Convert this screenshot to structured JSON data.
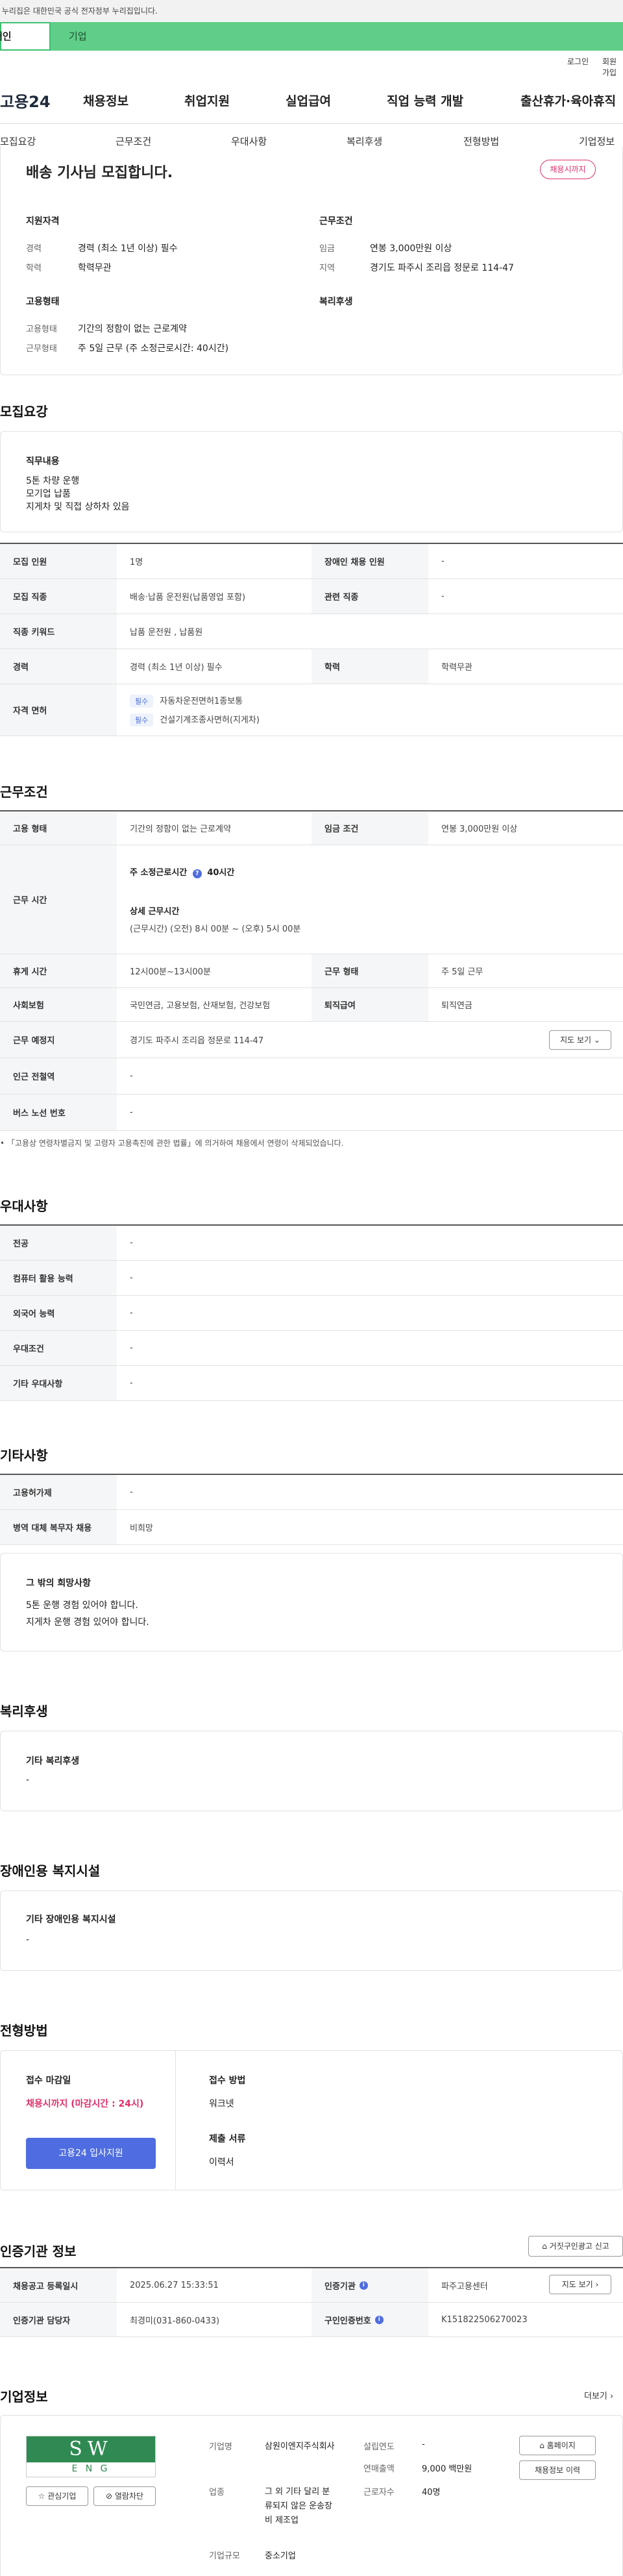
{
  "gov_banner": "이 누리집은 대한민국 공식 전자정부 누리집입니다.",
  "toggle": {
    "person": "개인",
    "corp": "기업"
  },
  "util": {
    "login": "로그인",
    "signup": "회원가입"
  },
  "logo": "고용24",
  "gnb": [
    "채용정보",
    "취업지원",
    "실업급여",
    "직업 능력 개발",
    "출산휴가·육아휴직"
  ],
  "tabs": [
    "모집요강",
    "근무조건",
    "우대사항",
    "복리후생",
    "전형방법",
    "기업정보"
  ],
  "job": {
    "title": "배송 기사님 모집합니다.",
    "badge": "채용시까지",
    "support_head": "지원자격",
    "career_label": "경력",
    "career_value": "경력 (최소 1년 이상) 필수",
    "edu_label": "학력",
    "edu_value": "학력무관",
    "work_head": "근무조건",
    "wage_label": "임금",
    "wage_value": "연봉 3,000만원 이상",
    "region_label": "지역",
    "region_value": "경기도 파주시 조리읍 정문로 114-47",
    "emp_head": "고용형태",
    "emp_type_label": "고용형태",
    "emp_type_value": "기간의 정함이 없는 근로계약",
    "work_type_label": "근무형태",
    "work_type_value": "주 5일 근무 (주 소정근로시간: 40시간)",
    "welfare_head": "복리후생"
  },
  "recruit": {
    "title": "모집요강",
    "duty_head": "직무내용",
    "duty_lines": [
      "5톤 차량 운행",
      "모기업 납품",
      "지게차 및 직접 상하차 있음"
    ],
    "rows": [
      {
        "k1": "모집 인원",
        "v1": "1명",
        "k2": "장애인 채용 인원",
        "v2": "-"
      },
      {
        "k1": "모집 직종",
        "v1": "배송·납품 운전원(납품영업 포함)",
        "k2": "관련 직종",
        "v2": "-"
      },
      {
        "k1": "직종 키워드",
        "v1": "납품 운전원 , 납품원"
      },
      {
        "k1": "경력",
        "v1": "경력 (최소 1년 이상) 필수",
        "k2": "학력",
        "v2": "학력무관"
      }
    ],
    "license_label": "자격 면허",
    "licenses": [
      {
        "tag": "필수",
        "name": "자동차운전면허1종보통"
      },
      {
        "tag": "필수",
        "name": "건설기계조종사면허(지게차)"
      }
    ]
  },
  "conditions": {
    "title": "근무조건",
    "emp_label": "고용 형태",
    "emp_value": "기간의 정함이 없는 근로계약",
    "wage_label": "임금 조건",
    "wage_value": "연봉 3,000만원 이상",
    "hours_label": "근무 시간",
    "hours_main": "주 소정근로시간",
    "hours_hours": "40시간",
    "hours_detail_head": "상세 근무시간",
    "hours_detail": "(근무시간) (오전) 8시 00분 ~ (오후) 5시 00분",
    "break_label": "휴게 시간",
    "break_value": "12시00분~13시00분",
    "worktype_label": "근무 형태",
    "worktype_value": "주 5일 근무",
    "insurance_label": "사회보험",
    "insurance_value": "국민연금, 고용보험, 산재보험, 건강보험",
    "retire_label": "퇴직급여",
    "retire_value": "퇴직연금",
    "place_label": "근무 예정지",
    "place_value": "경기도 파주시 조리읍 정문로 114-47",
    "map_btn": "지도 보기",
    "subway_label": "인근 전철역",
    "subway_value": "-",
    "bus_label": "버스 노선 번호",
    "bus_value": "-",
    "note": "「고용상 연령차별금지 및 고령자 고용촉진에 관한 법률」에 의거하여 채용에서 연령이 삭제되었습니다."
  },
  "preference": {
    "title": "우대사항",
    "rows": [
      {
        "k": "전공",
        "v": "-"
      },
      {
        "k": "컴퓨터 활용 능력",
        "v": "-"
      },
      {
        "k": "외국어 능력",
        "v": "-"
      },
      {
        "k": "우대조건",
        "v": "-"
      },
      {
        "k": "기타 우대사항",
        "v": "-"
      }
    ]
  },
  "etc": {
    "title": "기타사항",
    "rows": [
      {
        "k": "고용허가제",
        "v": "-"
      },
      {
        "k": "병역 대체 복무자 채용",
        "v": "비희망"
      }
    ],
    "hope_head": "그 밖의 희망사항",
    "hope_lines": [
      "5톤 운행 경험 있어야 합니다.",
      "지게차 운행 경험 있어야 합니다."
    ]
  },
  "welfare": {
    "title": "복리후생",
    "head": "기타 복리후생",
    "value": "-"
  },
  "disabled": {
    "title": "장애인용 복지시설",
    "head": "기타 장애인용 복지시설",
    "value": "-"
  },
  "screening": {
    "title": "전형방법",
    "deadline_head": "접수 마감일",
    "deadline_value": "채용시까지 (마감시간 : 24시)",
    "apply_btn": "고용24 입사지원",
    "method_head": "접수 방법",
    "method_value": "워크넷",
    "docs_head": "제출 서류",
    "docs_value": "이력서"
  },
  "cert": {
    "title": "인증기관 정보",
    "report_btn": "거짓구인광고 신고",
    "reg_label": "채용공고 등록일시",
    "reg_value": "2025.06.27 15:33:51",
    "org_label": "인증기관",
    "org_value": "파주고용센터",
    "map_btn": "지도 보기",
    "manager_label": "인증기관 담당자",
    "manager_value": "최경미(031-860-0433)",
    "auth_label": "구인인증번호",
    "auth_value": "K151822506270023"
  },
  "company": {
    "title": "기업정보",
    "more": "더보기",
    "logo_top": "SW",
    "logo_bottom": "E N G",
    "fav_btn": "관심기업",
    "block_btn": "열람차단",
    "name_label": "기업명",
    "name_value": "삼원이엔지주식회사",
    "biz_label": "업종",
    "biz_value": "그 외 기타 달리 분류되지 않은 운송장비 제조업",
    "size_label": "기업규모",
    "size_value": "중소기업",
    "year_label": "설립연도",
    "year_value": "-",
    "sales_label": "연매출액",
    "sales_value": "9,000 백만원",
    "emp_label": "근로자수",
    "emp_value": "40명",
    "home_btn": "홈페이지",
    "history_btn": "채용정보 이력"
  }
}
